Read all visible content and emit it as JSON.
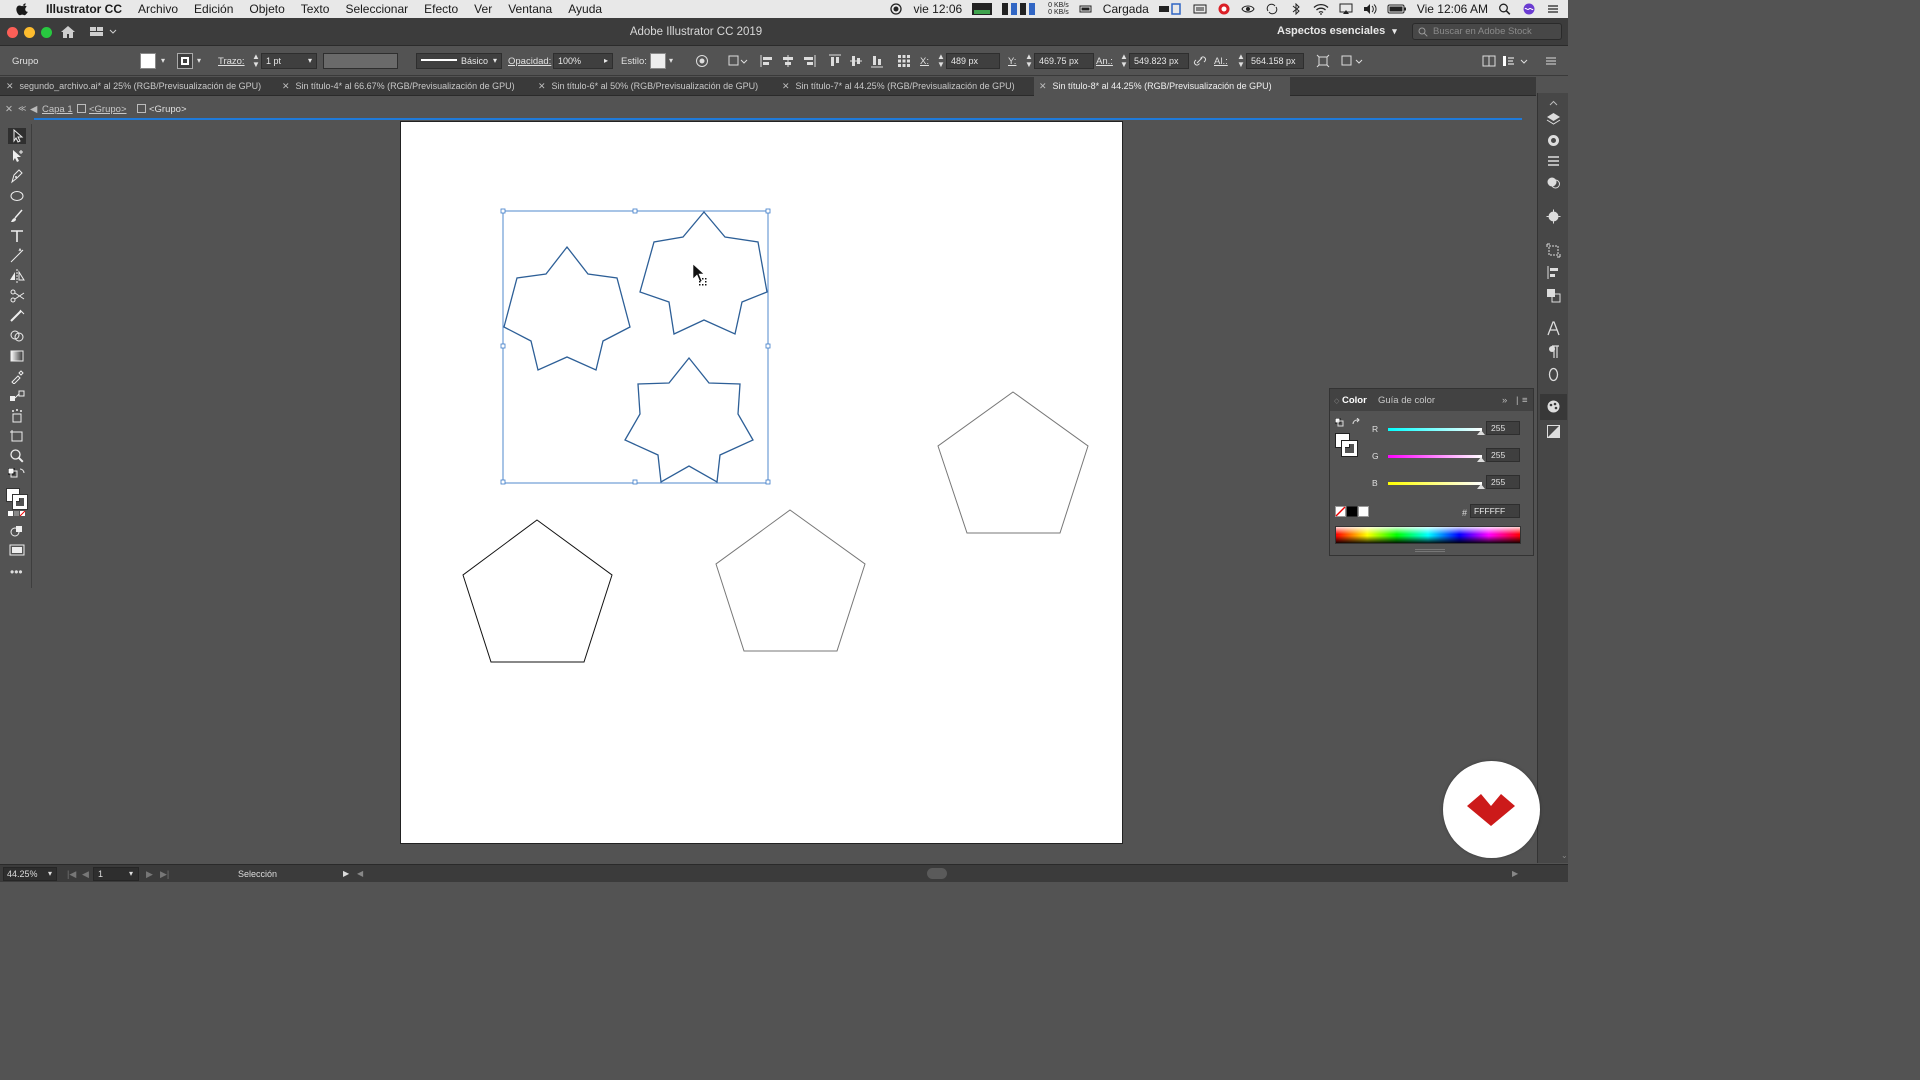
{
  "menubar": {
    "app": "Illustrator CC",
    "items": [
      "Archivo",
      "Edición",
      "Objeto",
      "Texto",
      "Seleccionar",
      "Efecto",
      "Ver",
      "Ventana",
      "Ayuda"
    ],
    "clock_short": "vie 12:06",
    "net_up": "0 KB/s",
    "net_down": "0 KB/s",
    "battery_status": "Cargada",
    "clock_full": "Vie 12:06 AM"
  },
  "window": {
    "title": "Adobe Illustrator CC 2019",
    "workspace": "Aspectos esenciales",
    "search_placeholder": "Buscar en Adobe Stock"
  },
  "control": {
    "selection_type": "Grupo",
    "stroke_label": "Trazo:",
    "stroke_value": "1 pt",
    "brush_label": "Básico",
    "opacity_label": "Opacidad:",
    "opacity_value": "100%",
    "style_label": "Estilo:",
    "x_label": "X:",
    "x_value": "489 px",
    "y_label": "Y:",
    "y_value": "469.75 px",
    "w_label": "An.:",
    "w_value": "549.823 px",
    "h_label": "Al.:",
    "h_value": "564.158 px"
  },
  "tabs": [
    {
      "label": "segundo_archivo.ai* al 25% (RGB/Previsualización de GPU)"
    },
    {
      "label": "Sin título-4* al 66.67% (RGB/Previsualización de GPU)"
    },
    {
      "label": "Sin título-6* al 50% (RGB/Previsualización de GPU)"
    },
    {
      "label": "Sin título-7* al 44.25% (RGB/Previsualización de GPU)"
    },
    {
      "label": "Sin título-8* al 44.25% (RGB/Previsualización de GPU)"
    }
  ],
  "breadcrumb": {
    "layer": "Capa 1",
    "group1": "<Grupo>",
    "group2": "<Grupo>"
  },
  "color_panel": {
    "tab_color": "Color",
    "tab_guide": "Guía de color",
    "r_label": "R",
    "r_value": "255",
    "g_label": "G",
    "g_value": "255",
    "b_label": "B",
    "b_value": "255",
    "hex_label": "#",
    "hex_value": "FFFFFF"
  },
  "status": {
    "zoom": "44.25%",
    "artboard_number": "1",
    "tool": "Selección"
  },
  "colors": {
    "selection": "#3d7cc9",
    "star_stroke": "#2d5f97",
    "accent": "#1f7ad9",
    "logo": "#cc1a1a"
  }
}
